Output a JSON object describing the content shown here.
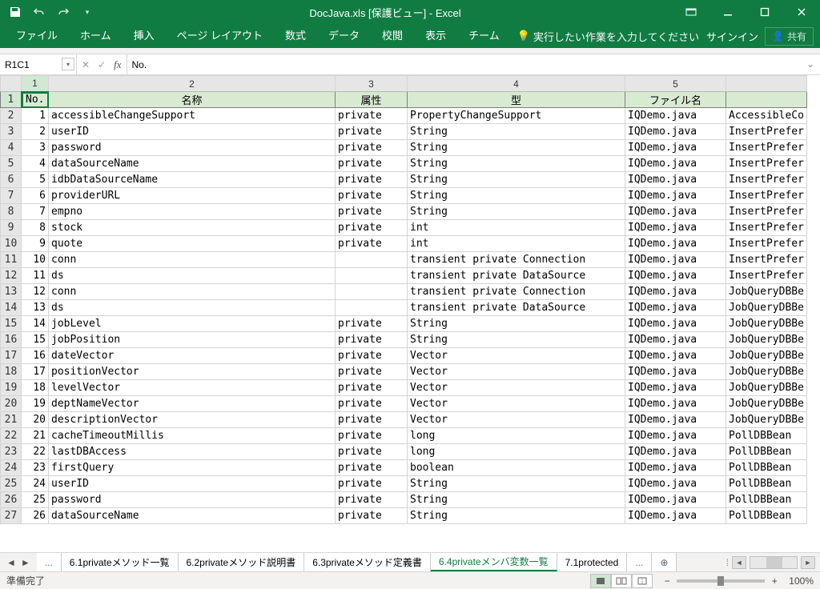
{
  "title": "DocJava.xls  [保護ビュー] - Excel",
  "qat": {
    "save": "save",
    "undo": "undo",
    "redo": "redo",
    "custom": "customize"
  },
  "ribbon": {
    "tabs": [
      "ファイル",
      "ホーム",
      "挿入",
      "ページ レイアウト",
      "数式",
      "データ",
      "校閲",
      "表示",
      "チーム"
    ],
    "tell": "実行したい作業を入力してください",
    "signin": "サインイン",
    "share": "共有"
  },
  "namebox": "R1C1",
  "formula": "No.",
  "columns": {
    "count": 5,
    "widths": [
      34,
      358,
      90,
      272,
      126,
      100
    ],
    "labels": [
      "1",
      "2",
      "3",
      "4",
      "5",
      ""
    ],
    "headers": [
      "No.",
      "名称",
      "属性",
      "型",
      "ファイル名",
      ""
    ]
  },
  "rows": [
    {
      "no": "1",
      "name": "accessibleChangeSupport",
      "attr": "private",
      "type": "PropertyChangeSupport",
      "file": "IQDemo.java",
      "extra": "AccessibleCo"
    },
    {
      "no": "2",
      "name": "userID",
      "attr": "private",
      "type": "String",
      "file": "IQDemo.java",
      "extra": "InsertPrefer"
    },
    {
      "no": "3",
      "name": "password",
      "attr": "private",
      "type": "String",
      "file": "IQDemo.java",
      "extra": "InsertPrefer"
    },
    {
      "no": "4",
      "name": "dataSourceName",
      "attr": "private",
      "type": "String",
      "file": "IQDemo.java",
      "extra": "InsertPrefer"
    },
    {
      "no": "5",
      "name": "idbDataSourceName",
      "attr": "private",
      "type": "String",
      "file": "IQDemo.java",
      "extra": "InsertPrefer"
    },
    {
      "no": "6",
      "name": "providerURL",
      "attr": "private",
      "type": "String",
      "file": "IQDemo.java",
      "extra": "InsertPrefer"
    },
    {
      "no": "7",
      "name": "empno",
      "attr": "private",
      "type": "String",
      "file": "IQDemo.java",
      "extra": "InsertPrefer"
    },
    {
      "no": "8",
      "name": "stock",
      "attr": "private",
      "type": "int",
      "file": "IQDemo.java",
      "extra": "InsertPrefer"
    },
    {
      "no": "9",
      "name": "quote",
      "attr": "private",
      "type": "int",
      "file": "IQDemo.java",
      "extra": "InsertPrefer"
    },
    {
      "no": "10",
      "name": "conn",
      "attr": "",
      "type": "transient private Connection",
      "file": "IQDemo.java",
      "extra": "InsertPrefer"
    },
    {
      "no": "11",
      "name": "ds",
      "attr": "",
      "type": "transient private DataSource",
      "file": "IQDemo.java",
      "extra": "InsertPrefer"
    },
    {
      "no": "12",
      "name": "conn",
      "attr": "",
      "type": "transient private Connection",
      "file": "IQDemo.java",
      "extra": "JobQueryDBBe"
    },
    {
      "no": "13",
      "name": "ds",
      "attr": "",
      "type": "transient private DataSource",
      "file": "IQDemo.java",
      "extra": "JobQueryDBBe"
    },
    {
      "no": "14",
      "name": "jobLevel",
      "attr": "private",
      "type": "String",
      "file": "IQDemo.java",
      "extra": "JobQueryDBBe"
    },
    {
      "no": "15",
      "name": "jobPosition",
      "attr": "private",
      "type": "String",
      "file": "IQDemo.java",
      "extra": "JobQueryDBBe"
    },
    {
      "no": "16",
      "name": "dateVector",
      "attr": "private",
      "type": "Vector",
      "file": "IQDemo.java",
      "extra": "JobQueryDBBe"
    },
    {
      "no": "17",
      "name": "positionVector",
      "attr": "private",
      "type": "Vector",
      "file": "IQDemo.java",
      "extra": "JobQueryDBBe"
    },
    {
      "no": "18",
      "name": "levelVector",
      "attr": "private",
      "type": "Vector",
      "file": "IQDemo.java",
      "extra": "JobQueryDBBe"
    },
    {
      "no": "19",
      "name": "deptNameVector",
      "attr": "private",
      "type": "Vector",
      "file": "IQDemo.java",
      "extra": "JobQueryDBBe"
    },
    {
      "no": "20",
      "name": "descriptionVector",
      "attr": "private",
      "type": "Vector",
      "file": "IQDemo.java",
      "extra": "JobQueryDBBe"
    },
    {
      "no": "21",
      "name": "cacheTimeoutMillis",
      "attr": "private",
      "type": "long",
      "file": "IQDemo.java",
      "extra": "PollDBBean"
    },
    {
      "no": "22",
      "name": "lastDBAccess",
      "attr": "private",
      "type": "long",
      "file": "IQDemo.java",
      "extra": "PollDBBean"
    },
    {
      "no": "23",
      "name": "firstQuery",
      "attr": "private",
      "type": "boolean",
      "file": "IQDemo.java",
      "extra": "PollDBBean"
    },
    {
      "no": "24",
      "name": "userID",
      "attr": "private",
      "type": "String",
      "file": "IQDemo.java",
      "extra": "PollDBBean"
    },
    {
      "no": "25",
      "name": "password",
      "attr": "private",
      "type": "String",
      "file": "IQDemo.java",
      "extra": "PollDBBean"
    },
    {
      "no": "26",
      "name": "dataSourceName",
      "attr": "private",
      "type": "String",
      "file": "IQDemo.java",
      "extra": "PollDBBean"
    }
  ],
  "sheets": {
    "more_left": "...",
    "tabs": [
      "6.1privateメソッド一覧",
      "6.2privateメソッド説明書",
      "6.3privateメソッド定義書",
      "6.4privateメンバ変数一覧",
      "7.1protected"
    ],
    "active": 3,
    "more_right": "...",
    "add": "+"
  },
  "status": {
    "ready": "準備完了",
    "zoom": "100%"
  }
}
